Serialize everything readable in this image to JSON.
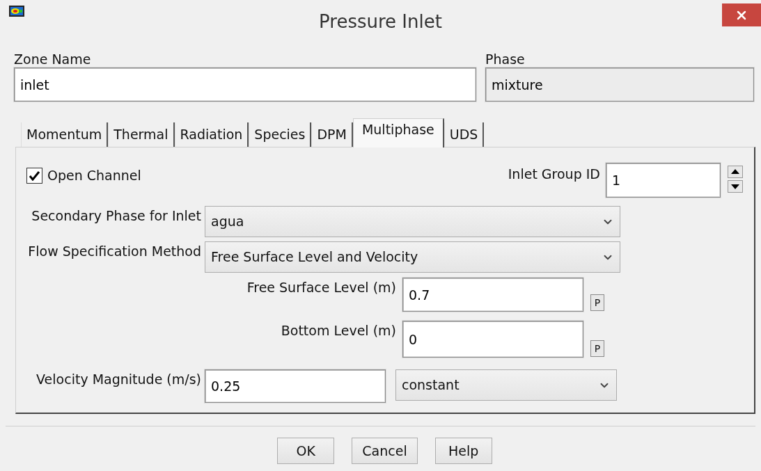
{
  "window": {
    "title": "Pressure Inlet"
  },
  "zone_name": {
    "label": "Zone Name",
    "value": "inlet"
  },
  "phase": {
    "label": "Phase",
    "value": "mixture",
    "disabled": true
  },
  "tabs": [
    {
      "label": "Momentum",
      "selected": false
    },
    {
      "label": "Thermal",
      "selected": false
    },
    {
      "label": "Radiation",
      "selected": false
    },
    {
      "label": "Species",
      "selected": false
    },
    {
      "label": "DPM",
      "selected": false
    },
    {
      "label": "Multiphase",
      "selected": true
    },
    {
      "label": "UDS",
      "selected": false
    }
  ],
  "open_channel": {
    "label": "Open Channel",
    "checked": true
  },
  "inlet_group_id": {
    "label": "Inlet Group ID",
    "value": "1"
  },
  "secondary_phase": {
    "label": "Secondary Phase for Inlet",
    "value": "agua"
  },
  "flow_method": {
    "label": "Flow Specification Method",
    "value": "Free Surface Level and Velocity"
  },
  "free_surface_level": {
    "label": "Free Surface Level (m)",
    "value": "0.7",
    "param_button": "P"
  },
  "bottom_level": {
    "label": "Bottom Level (m)",
    "value": "0",
    "param_button": "P"
  },
  "velocity": {
    "label": "Velocity Magnitude (m/s)",
    "value": "0.25",
    "profile": "constant"
  },
  "buttons": [
    "OK",
    "Cancel",
    "Help"
  ]
}
